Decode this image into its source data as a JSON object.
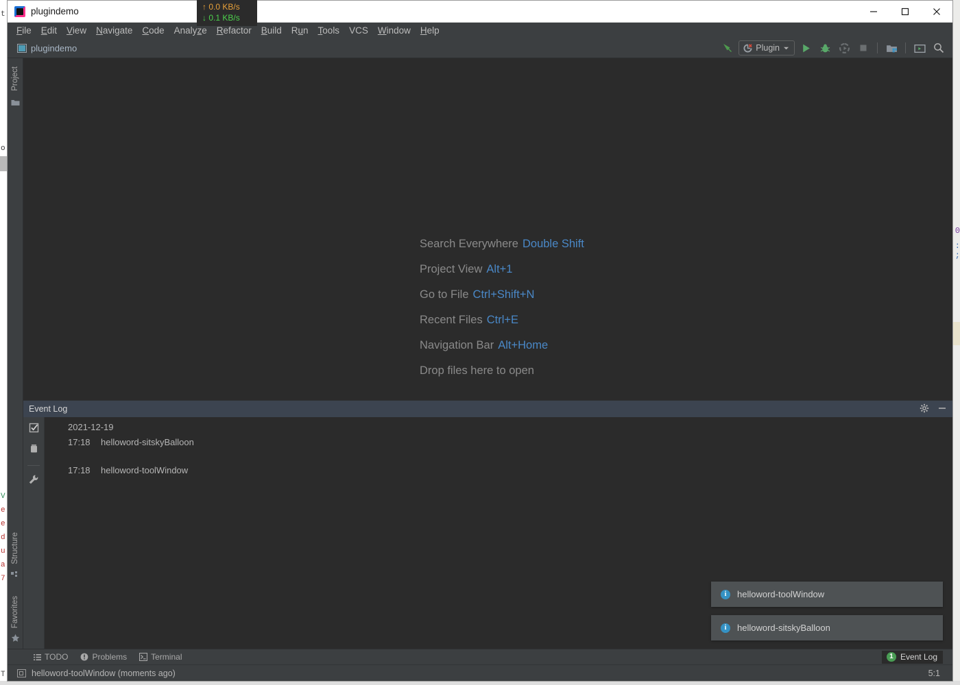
{
  "window": {
    "title": "plugindemo",
    "app_icon": "intellij-idea-icon",
    "controls": {
      "minimize": "minimize-button",
      "maximize": "maximize-button",
      "close": "close-button"
    }
  },
  "net_overlay": {
    "upload": "↑ 0.0 KB/s",
    "download": "↓ 0.1 KB/s",
    "upload_color": "#e8a13a",
    "download_color": "#4dd14d"
  },
  "menubar": {
    "items": [
      {
        "label": "File",
        "mnemonic": "F",
        "rest": "ile"
      },
      {
        "label": "Edit",
        "mnemonic": "E",
        "rest": "dit"
      },
      {
        "label": "View",
        "mnemonic": "V",
        "rest": "iew"
      },
      {
        "label": "Navigate",
        "mnemonic": "N",
        "rest": "avigate"
      },
      {
        "label": "Code",
        "mnemonic": "C",
        "rest": "ode"
      },
      {
        "label": "Analyze",
        "mnemonic": "",
        "rest": "Analyze"
      },
      {
        "label": "Refactor",
        "mnemonic": "R",
        "rest": "efactor"
      },
      {
        "label": "Build",
        "mnemonic": "B",
        "rest": "uild"
      },
      {
        "label": "Run",
        "mnemonic": "R",
        "rest": "un"
      },
      {
        "label": "Tools",
        "mnemonic": "T",
        "rest": "ools"
      },
      {
        "label": "VCS",
        "mnemonic": "",
        "rest": "VCS"
      },
      {
        "label": "Window",
        "mnemonic": "W",
        "rest": "indow"
      },
      {
        "label": "Help",
        "mnemonic": "H",
        "rest": "elp"
      }
    ]
  },
  "navbar": {
    "project": "plugindemo"
  },
  "toolbar": {
    "build_icon": "build-hammer-icon",
    "run_config": {
      "label": "Plugin",
      "icon": "plugin-icon",
      "chevron": "chevron-down-icon"
    },
    "run_icon": "run-icon",
    "debug_icon": "debug-bug-icon",
    "coverage_icon": "run-with-coverage-icon",
    "stop_icon": "stop-icon",
    "project_structure_icon": "project-structure-icon",
    "terminal_icon": "open-terminal-icon",
    "search_icon": "search-everywhere-icon"
  },
  "left_strip": {
    "top": [
      {
        "label": "Project",
        "icon": "project-folder-icon"
      }
    ],
    "bottom": [
      {
        "label": "Structure",
        "icon": "structure-icon"
      },
      {
        "label": "Favorites",
        "icon": "star-icon"
      }
    ]
  },
  "editor_hints": [
    {
      "action": "Search Everywhere",
      "shortcut": "Double Shift"
    },
    {
      "action": "Project View",
      "shortcut": "Alt+1"
    },
    {
      "action": "Go to File",
      "shortcut": "Ctrl+Shift+N"
    },
    {
      "action": "Recent Files",
      "shortcut": "Ctrl+E"
    },
    {
      "action": "Navigation Bar",
      "shortcut": "Alt+Home"
    },
    {
      "action": "Drop files here to open",
      "shortcut": ""
    }
  ],
  "event_log": {
    "title": "Event Log",
    "settings_icon": "gear-icon",
    "hide_icon": "hide-minimize-icon",
    "gutter": [
      {
        "icon": "mark-all-read-icon"
      },
      {
        "icon": "clear-all-trash-icon"
      },
      {
        "icon": "settings-wrench-icon"
      }
    ],
    "date": "2021-12-19",
    "entries": [
      {
        "time": "17:18",
        "message": "helloword-sitskyBalloon"
      },
      {
        "time": "17:18",
        "message": "helloword-toolWindow"
      }
    ]
  },
  "balloons": [
    {
      "icon": "info-icon",
      "message": "helloword-toolWindow"
    },
    {
      "icon": "info-icon",
      "message": "helloword-sitskyBalloon"
    }
  ],
  "bottom_bar": {
    "items": [
      {
        "label": "TODO",
        "icon": "todo-list-icon"
      },
      {
        "label": "Problems",
        "icon": "problems-icon"
      },
      {
        "label": "Terminal",
        "icon": "terminal-icon"
      }
    ],
    "event_log_tab": {
      "label": "Event Log",
      "badge": "1",
      "badge_color": "#499c54"
    }
  },
  "status_bar": {
    "icon": "tool-window-icon",
    "message": "helloword-toolWindow (moments ago)",
    "caret_position": "5:1"
  },
  "background": {
    "left_chars": [
      "t",
      "o",
      "V",
      "e",
      "e",
      "d",
      "u",
      "a",
      "7",
      "T"
    ],
    "right_chars": [
      "0",
      ":",
      ";"
    ]
  }
}
